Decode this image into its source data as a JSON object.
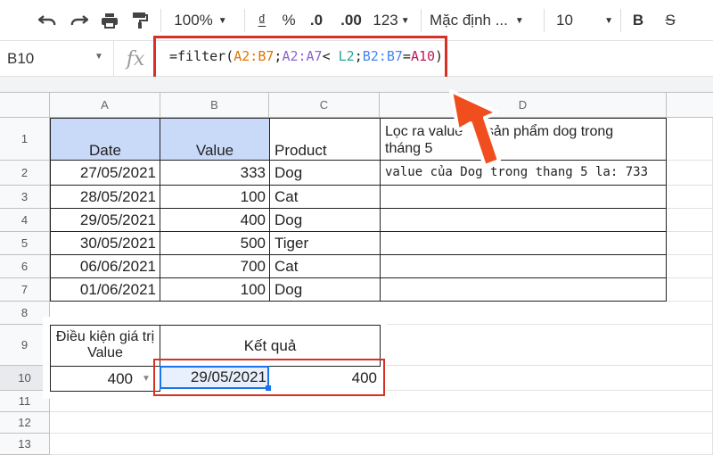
{
  "toolbar": {
    "undo_icon": "undo-icon",
    "redo_icon": "redo-icon",
    "print_icon": "print-icon",
    "paint_icon": "paint-format-icon",
    "zoom": "100%",
    "currency": "₫",
    "percent": "%",
    "dec_decrease": ".0",
    "dec_increase": ".00",
    "format_more": "123",
    "font": "Mặc định ...",
    "font_size": "10",
    "bold": "B",
    "strike": "S"
  },
  "formula_bar": {
    "cell_ref": "B10",
    "fx": "fx",
    "formula_parts": [
      "=filter(",
      "A2:B7",
      ";",
      "A2:A7",
      "< ",
      "L2",
      ";",
      "B2:B7",
      "=",
      "A10",
      ")"
    ],
    "colors": {
      "orange": "#e37400",
      "purple": "#8e63ce",
      "teal": "#26a69a",
      "blue": "#4285f4",
      "pink": "#c2185b",
      "red": "#d93025",
      "selection": "#1a73e8",
      "header_fill": "#c9daf8"
    }
  },
  "columns": [
    "A",
    "B",
    "C",
    "D"
  ],
  "rows": [
    "1",
    "2",
    "3",
    "4",
    "5",
    "6",
    "7",
    "8",
    "9",
    "10",
    "11",
    "12",
    "13"
  ],
  "table": {
    "headers": [
      "Date",
      "Value",
      "Product"
    ],
    "note_line1": "Lọc ra value      sản phẩm dog trong",
    "note_line2": "tháng 5",
    "data": [
      [
        "27/05/2021",
        "333",
        "Dog"
      ],
      [
        "28/05/2021",
        "100",
        "Cat"
      ],
      [
        "29/05/2021",
        "400",
        "Dog"
      ],
      [
        "30/05/2021",
        "500",
        "Tiger"
      ],
      [
        "06/06/2021",
        "700",
        "Cat"
      ],
      [
        "01/06/2021",
        "100",
        "Dog"
      ]
    ],
    "d2": "value của Dog trong thang 5 la: 733"
  },
  "panel": {
    "cond_line1": "Điều kiện giá trị",
    "cond_line2": "Value",
    "result_label": "Kết quả",
    "cond_value": "400",
    "result_date": "29/05/2021",
    "result_value": "400"
  }
}
